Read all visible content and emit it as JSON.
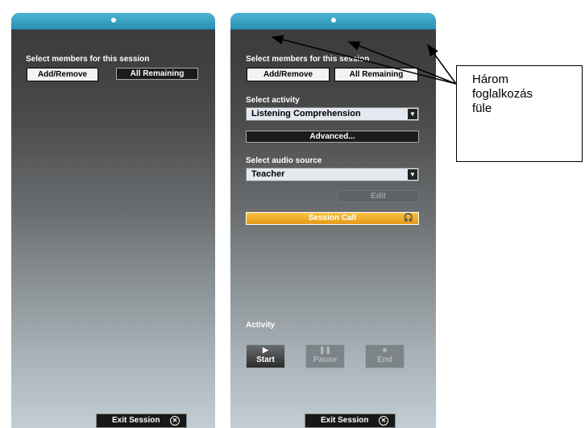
{
  "left_panel": {
    "label": "Select members for this session",
    "add_remove": "Add/Remove",
    "all_remaining": "All Remaining",
    "exit": "Exit Session"
  },
  "right_panel": {
    "members_label": "Select members for this session",
    "add_remove": "Add/Remove",
    "all_remaining": "All Remaining",
    "activity_label": "Select activity",
    "activity_value": "Listening Comprehension",
    "advanced": "Advanced...",
    "audio_label": "Select audio source",
    "audio_value": "Teacher",
    "edit": "Edit",
    "session_call": "Session Call",
    "activity_section": "Activity",
    "start": "Start",
    "pause": "Pause",
    "end": "End",
    "exit": "Exit Session"
  },
  "callout": {
    "line1": "Három",
    "line2": "foglalkozás",
    "line3": "füle"
  },
  "colors": {
    "tab_blue": "#2a9cc4",
    "session_call_orange": "#eeaa2a",
    "panel_dark": "#3b3b3b"
  }
}
